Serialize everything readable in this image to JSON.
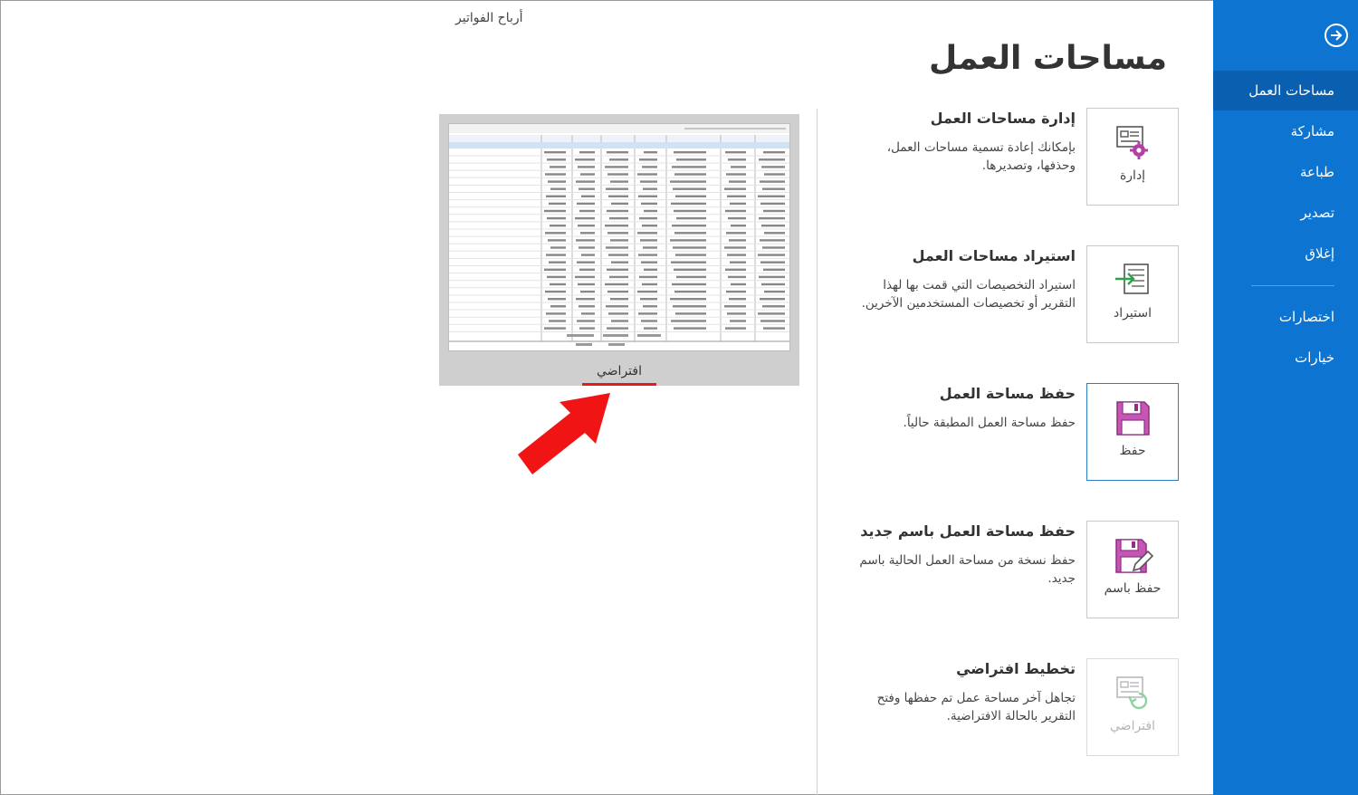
{
  "sidebar": {
    "items": [
      {
        "label": "مساحات العمل",
        "active": true
      },
      {
        "label": "مشاركة"
      },
      {
        "label": "طباعة"
      },
      {
        "label": "تصدير"
      },
      {
        "label": "إغلاق"
      },
      {
        "label": "اختصارات"
      },
      {
        "label": "خيارات"
      }
    ],
    "back_icon": "circle-arrow-right-icon",
    "color": "#0d74d1"
  },
  "breadcrumb": "أرباح الفواتير",
  "page_title": "مساحات العمل",
  "actions": [
    {
      "heading": "إدارة مساحات العمل",
      "description": "بإمكانك إعادة تسمية مساحات العمل، وحذفها، وتصديرها.",
      "tile_label": "إدارة",
      "icon": "manage-workspaces-icon"
    },
    {
      "heading": "استيراد مساحات العمل",
      "description": "استيراد التخصيصات التي قمت بها لهذا التقرير أو تخصيصات المستخدمين الآخرين.",
      "tile_label": "استيراد",
      "icon": "import-icon"
    },
    {
      "heading": "حفظ مساحة العمل",
      "description": "حفظ مساحة العمل المطبقة حالياً.",
      "tile_label": "حفظ",
      "icon": "save-icon"
    },
    {
      "heading": "حفظ مساحة العمل باسم جديد",
      "description": "حفظ نسخة من مساحة العمل الحالية باسم جديد.",
      "tile_label": "حفظ باسم",
      "icon": "save-as-icon"
    },
    {
      "heading": "تخطيط افتراضي",
      "description": "تجاهل آخر مساحة عمل تم حفظها وفتح التقرير بالحالة الافتراضية.",
      "tile_label": "افتراضي",
      "icon": "reset-layout-icon"
    }
  ],
  "preview": {
    "label": "افتراضي",
    "accent": "#e31b1b"
  }
}
